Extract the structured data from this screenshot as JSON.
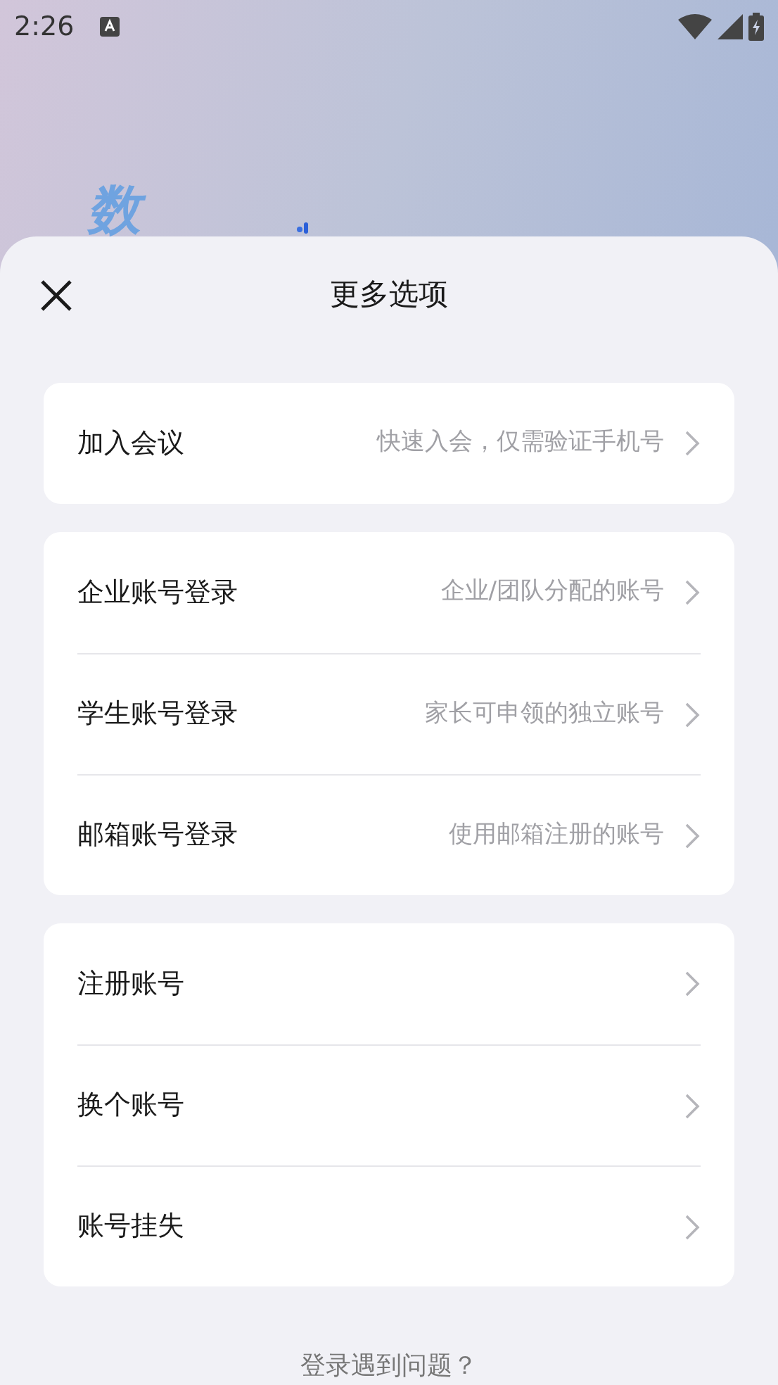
{
  "status_bar": {
    "time": "2:26"
  },
  "background": {
    "logo_text": "数"
  },
  "sheet": {
    "title": "更多选项",
    "groups": [
      [
        {
          "label": "加入会议",
          "hint": "快速入会，仅需验证手机号"
        }
      ],
      [
        {
          "label": "企业账号登录",
          "hint": "企业/团队分配的账号"
        },
        {
          "label": "学生账号登录",
          "hint": "家长可申领的独立账号"
        },
        {
          "label": "邮箱账号登录",
          "hint": "使用邮箱注册的账号"
        }
      ],
      [
        {
          "label": "注册账号"
        },
        {
          "label": "换个账号"
        },
        {
          "label": "账号挂失"
        }
      ]
    ],
    "footer_link": "登录遇到问题？"
  }
}
